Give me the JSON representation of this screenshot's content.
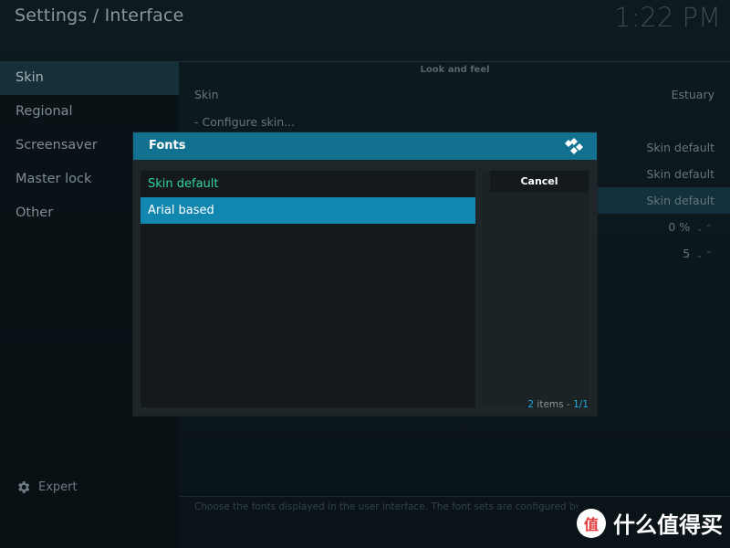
{
  "header": {
    "title": "Settings / Interface",
    "clock": "1:22 PM"
  },
  "sidebar": {
    "items": [
      {
        "label": "Skin",
        "active": true
      },
      {
        "label": "Regional",
        "active": false
      },
      {
        "label": "Screensaver",
        "active": false
      },
      {
        "label": "Master lock",
        "active": false
      },
      {
        "label": "Other",
        "active": false
      }
    ],
    "expert_label": "Expert"
  },
  "content": {
    "group_label": "Look and feel",
    "rows": [
      {
        "label": "Skin",
        "value": "Estuary"
      },
      {
        "label": "- Configure skin...",
        "value": ""
      },
      {
        "label": "",
        "value": "Skin default"
      },
      {
        "label": "",
        "value": "Skin default"
      },
      {
        "label": "",
        "value": "Skin default"
      },
      {
        "label": "",
        "value": "0 %"
      },
      {
        "label": "",
        "value": "5"
      }
    ],
    "hint": "Choose the fonts displayed in the user interface. The font sets are configured by your skin."
  },
  "dialog": {
    "title": "Fonts",
    "items": [
      {
        "label": "Skin default",
        "state": "current"
      },
      {
        "label": "Arial based",
        "state": "selected"
      }
    ],
    "cancel_label": "Cancel",
    "count_num": "2",
    "count_text": " items - ",
    "page": "1/1"
  },
  "watermark": {
    "text": "什么值得买",
    "badge": "值"
  },
  "colors": {
    "accent": "#12718f",
    "selected": "#1187b0",
    "current_item": "#33d49e"
  },
  "icons": [
    "gear-icon",
    "kodi-logo-icon",
    "spin-arrows-icon"
  ]
}
